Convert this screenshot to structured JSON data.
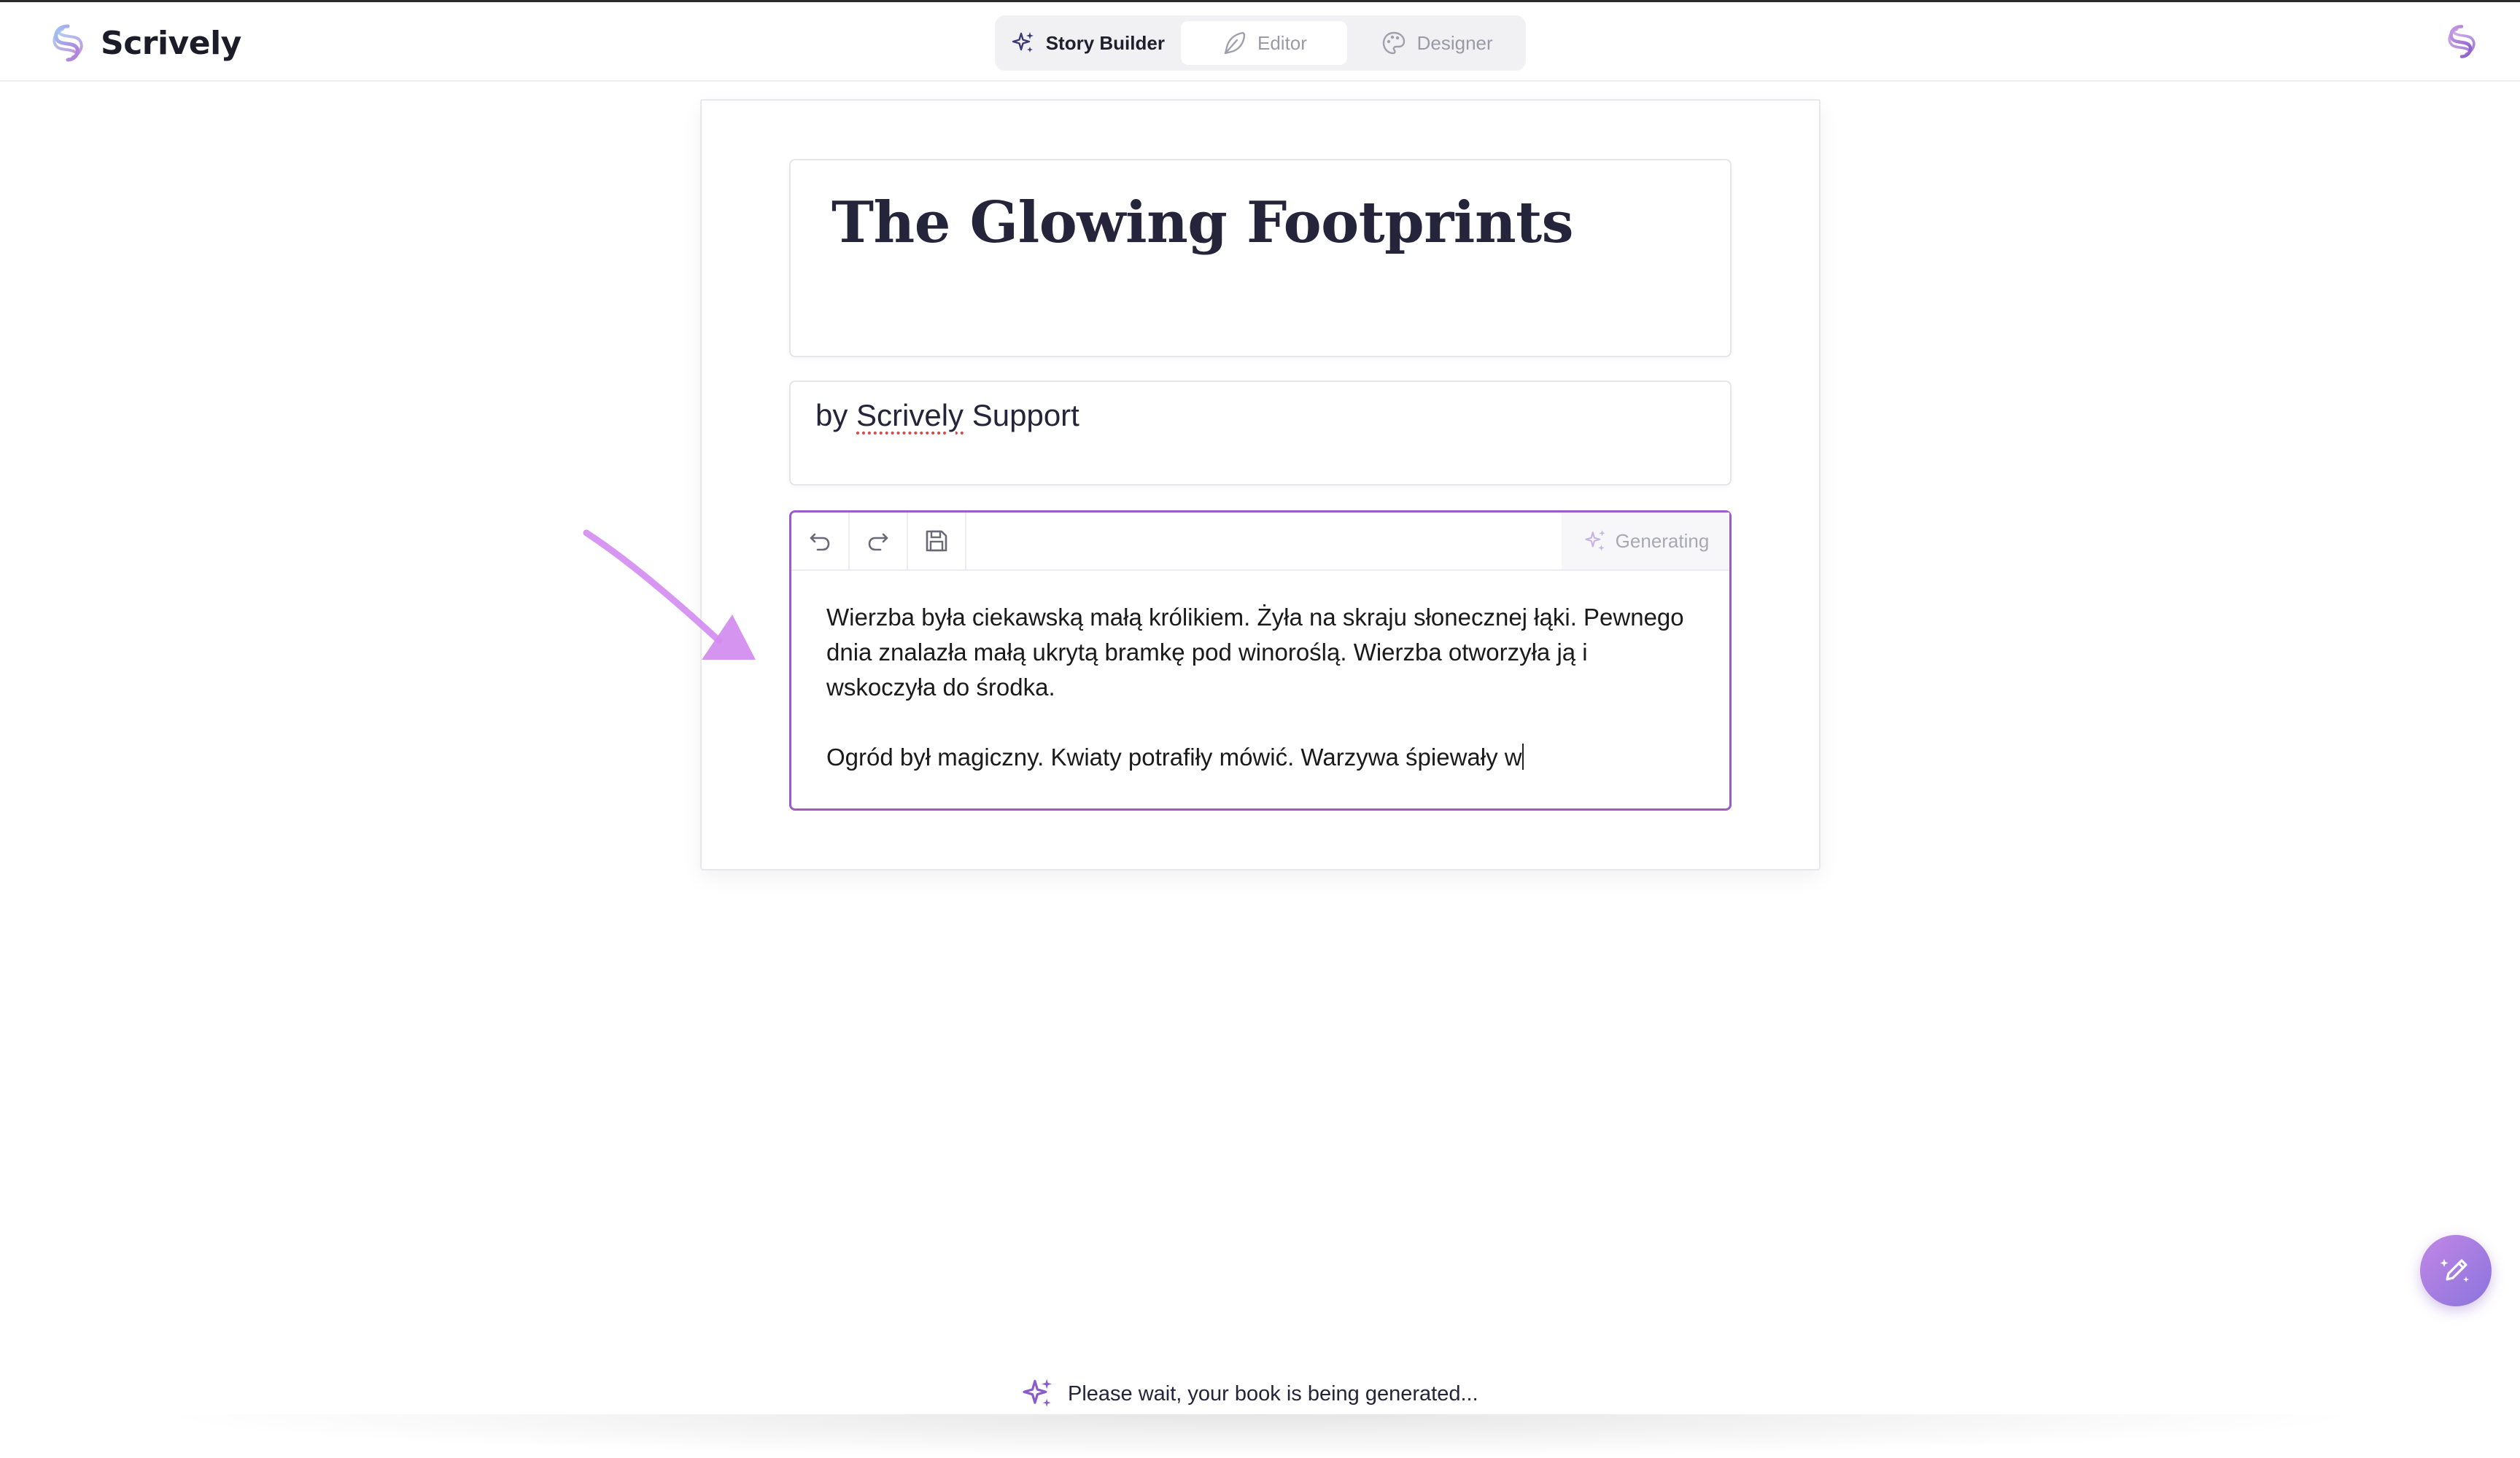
{
  "app": {
    "name": "Scrively"
  },
  "mode_switch": {
    "tabs": [
      {
        "label": "Story Builder",
        "icon": "sparkles-icon"
      },
      {
        "label": "Editor",
        "icon": "feather-pen-icon"
      },
      {
        "label": "Designer",
        "icon": "palette-icon"
      }
    ]
  },
  "book": {
    "title": "The Glowing Footprints",
    "author_prefix": "by",
    "author_name": "Scrively",
    "author_suffix": "Support"
  },
  "editor": {
    "toolbar": {
      "undo": "undo-icon",
      "redo": "redo-icon",
      "save": "save-icon"
    },
    "status": "Generating",
    "paragraphs": [
      "Wierzba była ciekawską małą królikiem. Żyła na skraju słonecznej łąki. Pewnego dnia znalazła małą ukrytą bramkę pod winoroślą. Wierzba otworzyła ją i wskoczyła do środka.",
      "Ogród był magiczny. Kwiaty potrafiły mówić. Warzywa śpiewały w"
    ]
  },
  "status_bar": {
    "message": "Please wait, your book is being generated..."
  },
  "colors": {
    "accent": "#9b5cc9",
    "annotation_arrow": "#d38bf0",
    "fab_gradient_start": "#c287e6",
    "fab_gradient_end": "#8a74dc"
  }
}
